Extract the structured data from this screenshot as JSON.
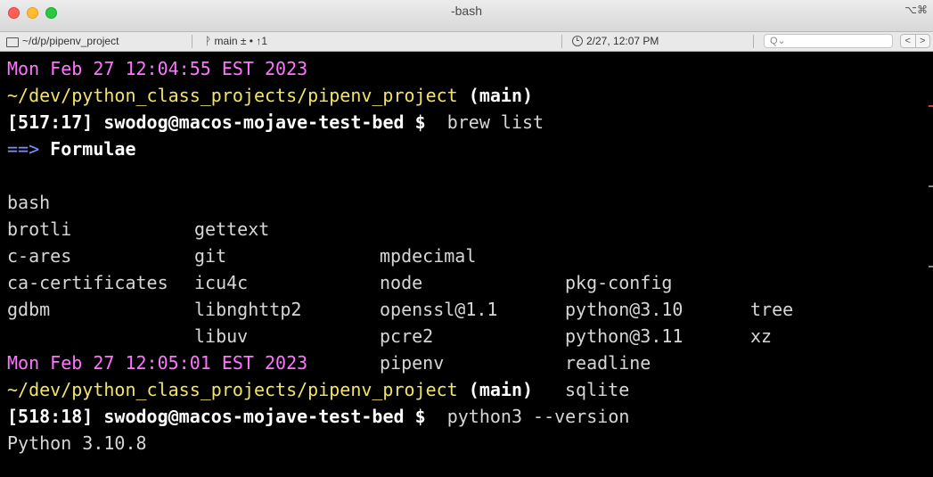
{
  "window": {
    "title": "-bash",
    "shortcut_glyph": "⌥⌘"
  },
  "statusbar": {
    "path": "~/d/p/pipenv_project",
    "git": "ᚹ main ± • ↑1",
    "clock": "2/27, 12:07 PM",
    "search_placeholder": "Q⌄",
    "nav_prev": "<",
    "nav_next": ">"
  },
  "terminal": {
    "block1": {
      "timestamp": "Mon Feb 27 12:04:55 EST 2023",
      "cwd": "~/dev/python_class_projects/pipenv_project",
      "branch": "(main)",
      "counter": "[517:17]",
      "user_host": "swodog@macos-mojave-test-bed",
      "prompt": "$",
      "command": "brew list",
      "arrow": "==>",
      "heading": "Formulae",
      "formulae": [
        [
          "bash",
          "gettext",
          "mpdecimal",
          "pkg-config",
          "tree"
        ],
        [
          "brotli",
          "git",
          "node",
          "python@3.10",
          "xz"
        ],
        [
          "c-ares",
          "icu4c",
          "openssl@1.1",
          "python@3.11",
          ""
        ],
        [
          "ca-certificates",
          "libnghttp2",
          "pcre2",
          "readline",
          ""
        ],
        [
          "gdbm",
          "libuv",
          "pipenv",
          "sqlite",
          ""
        ]
      ]
    },
    "block2": {
      "timestamp": "Mon Feb 27 12:05:01 EST 2023",
      "cwd": "~/dev/python_class_projects/pipenv_project",
      "branch": "(main)",
      "counter": "[518:18]",
      "user_host": "swodog@macos-mojave-test-bed",
      "prompt": "$",
      "command": "python3 --version",
      "output": "Python 3.10.8"
    }
  },
  "colors": {
    "timestamp": "#ff75ff",
    "cwd": "#f2e464",
    "arrow": "#7f8dff",
    "text": "#d6d6d6",
    "background": "#000000"
  }
}
